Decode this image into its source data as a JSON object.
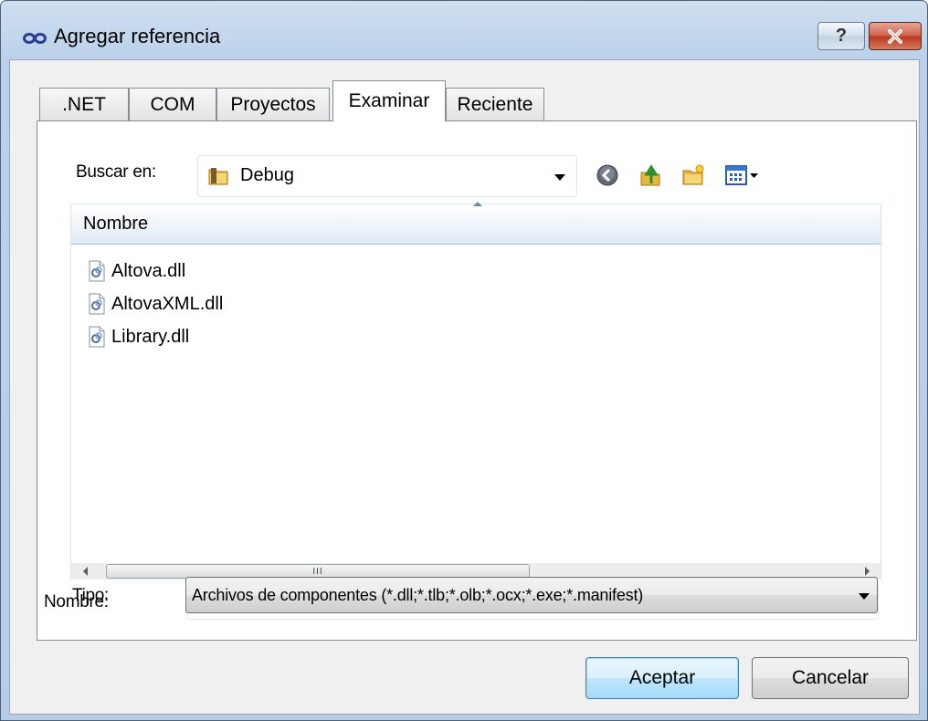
{
  "window": {
    "title": "Agregar referencia",
    "help_glyph": "?",
    "icon": "add-reference-link-icon"
  },
  "tabs": [
    {
      "label": ".NET",
      "active": false
    },
    {
      "label": "COM",
      "active": false
    },
    {
      "label": "Proyectos",
      "active": false
    },
    {
      "label": "Examinar",
      "active": true
    },
    {
      "label": "Reciente",
      "active": false
    }
  ],
  "browse": {
    "look_in_label": "Buscar en:",
    "look_in_value": "Debug",
    "tools": [
      "back-icon",
      "up-folder-icon",
      "new-folder-icon",
      "view-menu-icon"
    ]
  },
  "file_list": {
    "column_header": "Nombre",
    "files": [
      "Altova.dll",
      "AltovaXML.dll",
      "Library.dll"
    ],
    "scroll_thumb_grip": "III"
  },
  "name_field": {
    "label": "Nombre:",
    "value": ""
  },
  "type_field": {
    "label": "Tipo:",
    "value": "Archivos de componentes (*.dll;*.tlb;*.olb;*.ocx;*.exe;*.manifest)"
  },
  "buttons": {
    "ok": "Aceptar",
    "cancel": "Cancelar"
  },
  "colors": {
    "title_bar": "#bcd2ea",
    "client_bg": "#f0f0f0",
    "close_button": "#c8452a",
    "default_button_border": "#3c7fb1"
  }
}
